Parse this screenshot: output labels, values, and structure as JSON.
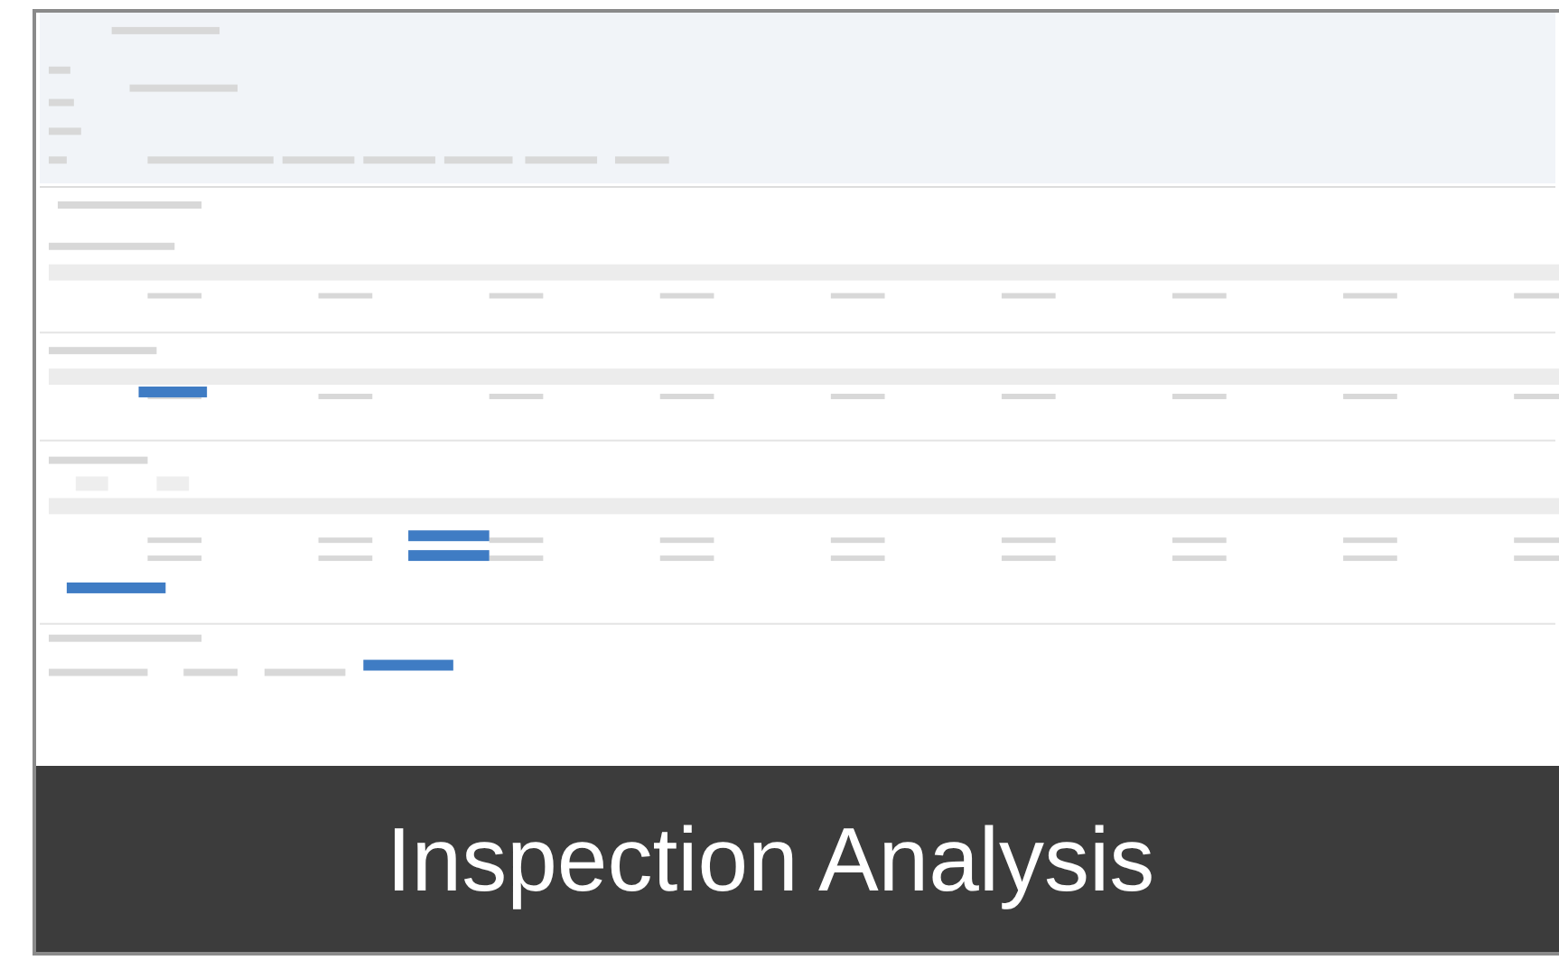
{
  "caption": "Inspection Analysis"
}
